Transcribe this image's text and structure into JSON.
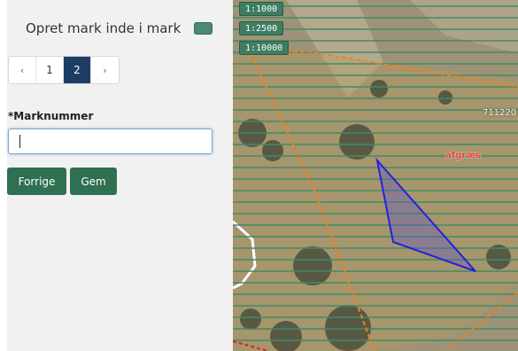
{
  "panel": {
    "title": "Opret mark inde i mark",
    "swatch_color": "#4a8a72"
  },
  "pagination": {
    "prev_icon": "chevron-left-icon",
    "pages": [
      "1",
      "2"
    ],
    "active_page": "2",
    "next_icon": "chevron-right-icon"
  },
  "form": {
    "field_label": "*Marknummer",
    "field_value": "",
    "prev_button": "Forrige",
    "save_button": "Gem"
  },
  "map": {
    "scales": [
      "1:1000",
      "1:2500",
      "1:10000"
    ],
    "field_number": "711220",
    "crop_label": "afgræs",
    "colors": {
      "stripes": "#3f8a6a",
      "field_boundary": "#f08020",
      "drawn_polygon": "#2222dd",
      "crop_label": "#e84040"
    }
  }
}
